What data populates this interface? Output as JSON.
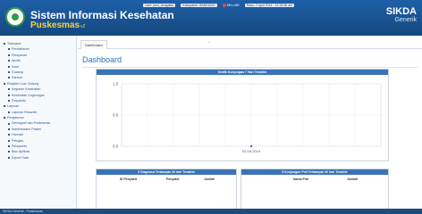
{
  "header": {
    "title": "Sistem Informasi Kesehatan",
    "subtitle": "Puskesmas",
    "version": "v2",
    "brand_name": "SIKDA",
    "brand_sub": "Generik",
    "user_text": "User: pkm_sengatan",
    "location_text": "Kabupaten: BANDUNG",
    "logout_label": "KELUAR",
    "date_text": "Rabu, 2 April 2014 - 12:34:56 am"
  },
  "sidebar": {
    "items": [
      {
        "label": "Transaksi",
        "level": 0
      },
      {
        "label": "Pendaftaran",
        "level": 1
      },
      {
        "label": "Pelayanan",
        "level": 1
      },
      {
        "label": "Apotik",
        "level": 1
      },
      {
        "label": "Kasir",
        "level": 1
      },
      {
        "label": "Gudang",
        "level": 1
      },
      {
        "label": "Sarana",
        "level": 1
      },
      {
        "label": "Register Luar Gedung",
        "level": 0
      },
      {
        "label": "Kegiatan Kesehatan",
        "level": 1
      },
      {
        "label": "Kesehatan Lingkungan",
        "level": 1
      },
      {
        "label": "Posyandu",
        "level": 1
      },
      {
        "label": "Laporan",
        "level": 0
      },
      {
        "label": "Laporan Rekamin",
        "level": 1
      },
      {
        "label": "Pengaturan",
        "level": 0
      },
      {
        "label": "Demografi dan Puskesmas",
        "level": 1
      },
      {
        "label": "Administrator Pasien",
        "level": 1
      },
      {
        "label": "Farmasi",
        "level": 1
      },
      {
        "label": "Petugas",
        "level": 1
      },
      {
        "label": "Pelayanan",
        "level": 1
      },
      {
        "label": "Bisu Aplikasi",
        "level": 1
      },
      {
        "label": "Export Data",
        "level": 1
      }
    ]
  },
  "main": {
    "tab_label": "Dashboard",
    "collapse_mark": "^",
    "page_title": "Dashboard"
  },
  "chart_panel": {
    "heading": "Grafik Kunjungan 7 Hari Terakhir"
  },
  "table1": {
    "heading": "5 Diagnosa Terbanyak 30 hari Terakhir",
    "columns": [
      "ID Penyakit",
      "Penyakit",
      "Jumlah"
    ]
  },
  "table2": {
    "heading": "5 Kunjungan Poli Terbanyak 30 hari Terakhir",
    "columns": [
      "Nama Poli",
      "Jumlah"
    ]
  },
  "footer": {
    "text": "SIKDA Generik - Puskesmas"
  },
  "chart_data": {
    "type": "line",
    "x": [
      "02-04-2014"
    ],
    "series": [
      {
        "values": [
          0
        ]
      }
    ],
    "ylim": [
      0,
      1
    ],
    "yticks": [
      "1.0",
      "0.5",
      "0.0"
    ],
    "grid": true
  },
  "colors": {
    "header_blue": "#1f5fa8",
    "accent_yellow": "#f5d33b",
    "panel_head": "#3a73b6",
    "link_blue": "#2b5a8c"
  }
}
